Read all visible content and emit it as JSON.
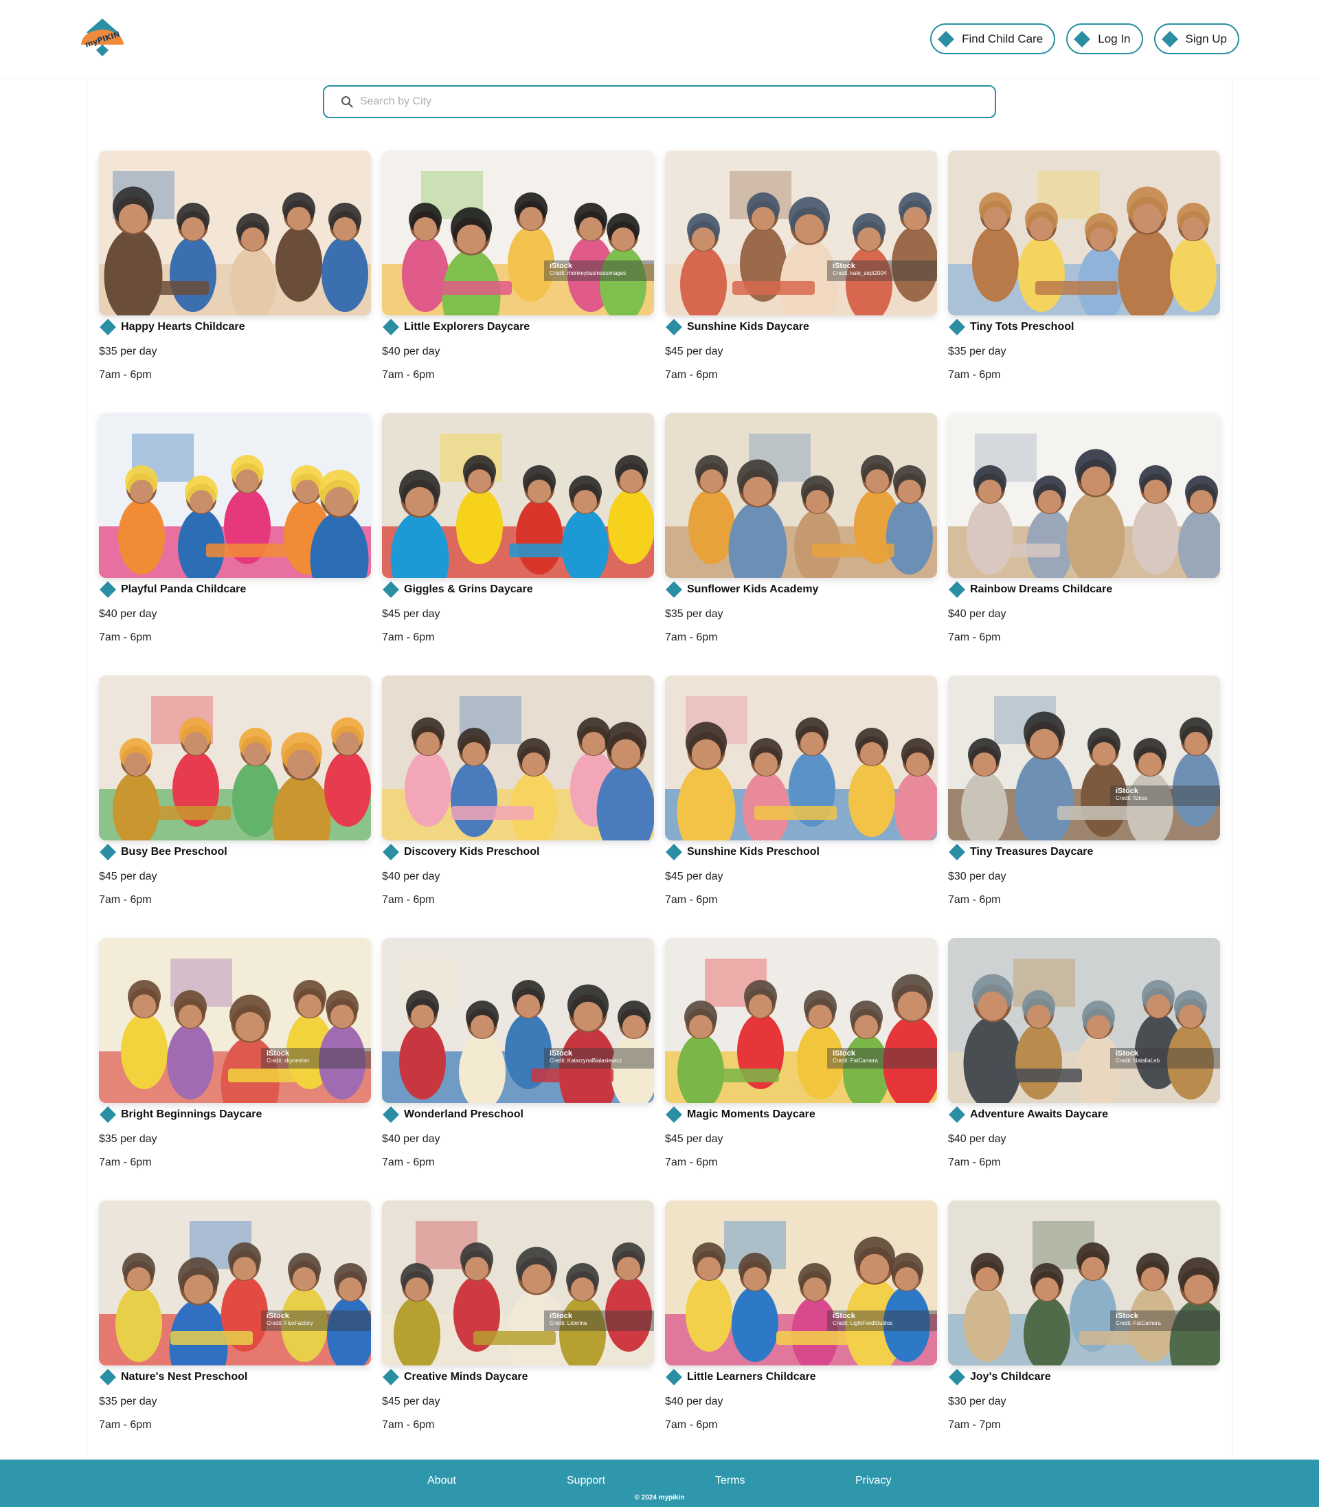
{
  "brand": {
    "logo_text": "myPIKIN",
    "accent": "#2a8fa3",
    "logo_orange": "#f08a3c"
  },
  "nav": [
    {
      "label": "Find Child Care",
      "icon": "diamond-icon"
    },
    {
      "label": "Log In",
      "icon": "diamond-icon"
    },
    {
      "label": "Sign Up",
      "icon": "diamond-icon"
    }
  ],
  "search": {
    "placeholder": "Search by City",
    "icon": "search-icon"
  },
  "listings": [
    {
      "name": "Happy Hearts Childcare",
      "price": "$35 per day",
      "hours": "7am - 6pm",
      "watermark": ""
    },
    {
      "name": "Little Explorers Daycare",
      "price": "$40 per day",
      "hours": "7am - 6pm",
      "watermark": "iStock",
      "credit": "Credit: monkeybusinessimages"
    },
    {
      "name": "Sunshine Kids Daycare",
      "price": "$45 per day",
      "hours": "7am - 6pm",
      "watermark": "iStock",
      "credit": "Credit: kate_sept2004"
    },
    {
      "name": "Tiny Tots Preschool",
      "price": "$35 per day",
      "hours": "7am - 6pm",
      "watermark": ""
    },
    {
      "name": "Playful Panda Childcare",
      "price": "$40 per day",
      "hours": "7am - 6pm",
      "watermark": ""
    },
    {
      "name": "Giggles & Grins Daycare",
      "price": "$45 per day",
      "hours": "7am - 6pm",
      "watermark": ""
    },
    {
      "name": "Sunflower Kids Academy",
      "price": "$35 per day",
      "hours": "7am - 6pm",
      "watermark": ""
    },
    {
      "name": "Rainbow Dreams Childcare",
      "price": "$40 per day",
      "hours": "7am - 6pm",
      "watermark": ""
    },
    {
      "name": "Busy Bee Preschool",
      "price": "$45 per day",
      "hours": "7am - 6pm",
      "watermark": ""
    },
    {
      "name": "Discovery Kids Preschool",
      "price": "$40 per day",
      "hours": "7am - 6pm",
      "watermark": ""
    },
    {
      "name": "Sunshine Kids Preschool",
      "price": "$45 per day",
      "hours": "7am - 6pm",
      "watermark": ""
    },
    {
      "name": "Tiny Treasures Daycare",
      "price": "$30 per day",
      "hours": "7am - 6pm",
      "watermark": "iStock",
      "credit": "Credit: fizkes"
    },
    {
      "name": "Bright Beginnings Daycare",
      "price": "$35 per day",
      "hours": "7am - 6pm",
      "watermark": "iStock",
      "credit": "Credit: skynesher"
    },
    {
      "name": "Wonderland Preschool",
      "price": "$40 per day",
      "hours": "7am - 6pm",
      "watermark": "iStock",
      "credit": "Credit: KatarzynaBialasiewicz"
    },
    {
      "name": "Magic Moments Daycare",
      "price": "$45 per day",
      "hours": "7am - 6pm",
      "watermark": "iStock",
      "credit": "Credit: FatCamera"
    },
    {
      "name": "Adventure Awaits Daycare",
      "price": "$40 per day",
      "hours": "7am - 6pm",
      "watermark": "iStock",
      "credit": "Credit: NataliaLeb"
    },
    {
      "name": "Nature's Nest Preschool",
      "price": "$35 per day",
      "hours": "7am - 6pm",
      "watermark": "iStock",
      "credit": "Credit: FluxFactory"
    },
    {
      "name": "Creative Minds Daycare",
      "price": "$45 per day",
      "hours": "7am - 6pm",
      "watermark": "iStock",
      "credit": "Credit: Liderina"
    },
    {
      "name": "Little Learners Childcare",
      "price": "$40 per day",
      "hours": "7am - 6pm",
      "watermark": "iStock",
      "credit": "Credit: LightFieldStudios"
    },
    {
      "name": "Joy's Childcare",
      "price": "$30 per day",
      "hours": "7am - 7pm",
      "watermark": "iStock",
      "credit": "Credit: FatCamera"
    }
  ],
  "footer": {
    "links": [
      "About",
      "Support",
      "Terms",
      "Privacy"
    ],
    "copyright": "© 2024 mypikin",
    "bg": "#2e97ab"
  }
}
